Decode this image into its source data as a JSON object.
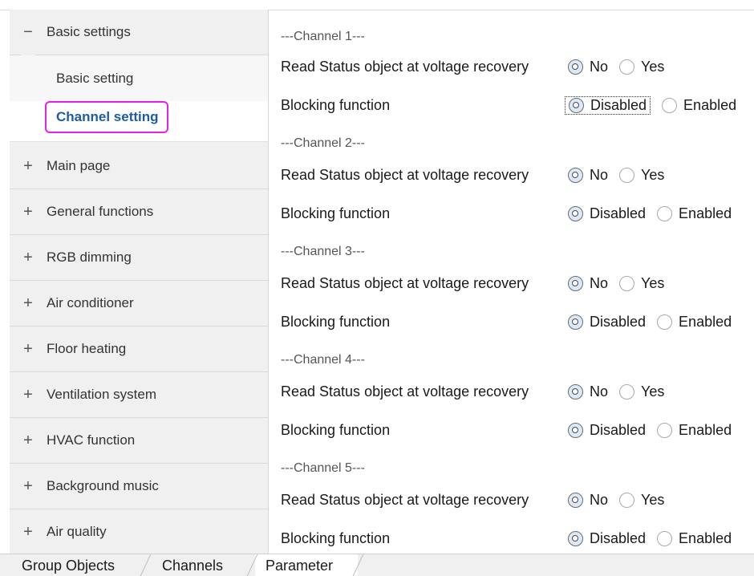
{
  "sidebar": {
    "groups": [
      {
        "sign": "−",
        "label": "Basic settings"
      },
      {
        "sign": "+",
        "label": "Main page"
      },
      {
        "sign": "+",
        "label": "General functions"
      },
      {
        "sign": "+",
        "label": "RGB dimming"
      },
      {
        "sign": "+",
        "label": "Air conditioner"
      },
      {
        "sign": "+",
        "label": "Floor heating"
      },
      {
        "sign": "+",
        "label": "Ventilation system"
      },
      {
        "sign": "+",
        "label": "HVAC function"
      },
      {
        "sign": "+",
        "label": "Background music"
      },
      {
        "sign": "+",
        "label": "Air quality"
      }
    ],
    "subitems": [
      {
        "label": "Basic setting"
      },
      {
        "label": "Channel setting",
        "selected": true
      }
    ],
    "highlight_color": "#e620e6",
    "selected_text_color": "#1e5aa8"
  },
  "parameters": {
    "channels": [
      {
        "header": "---Channel 1---",
        "read_status_label": "Read Status object at voltage recovery",
        "read_status_options": [
          "No",
          "Yes"
        ],
        "read_status_value": "No",
        "blocking_label": "Blocking function",
        "blocking_options": [
          "Disabled",
          "Enabled"
        ],
        "blocking_value": "Disabled"
      },
      {
        "header": "---Channel 2---",
        "read_status_label": "Read Status object at voltage recovery",
        "read_status_options": [
          "No",
          "Yes"
        ],
        "read_status_value": "No",
        "blocking_label": "Blocking function",
        "blocking_options": [
          "Disabled",
          "Enabled"
        ],
        "blocking_value": "Disabled"
      },
      {
        "header": "---Channel 3---",
        "read_status_label": "Read Status object at voltage recovery",
        "read_status_options": [
          "No",
          "Yes"
        ],
        "read_status_value": "No",
        "blocking_label": "Blocking function",
        "blocking_options": [
          "Disabled",
          "Enabled"
        ],
        "blocking_value": "Disabled"
      },
      {
        "header": "---Channel 4---",
        "read_status_label": "Read Status object at voltage recovery",
        "read_status_options": [
          "No",
          "Yes"
        ],
        "read_status_value": "No",
        "blocking_label": "Blocking function",
        "blocking_options": [
          "Disabled",
          "Enabled"
        ],
        "blocking_value": "Disabled"
      },
      {
        "header": "---Channel 5---",
        "read_status_label": "Read Status object at voltage recovery",
        "read_status_options": [
          "No",
          "Yes"
        ],
        "read_status_value": "No",
        "blocking_label": "Blocking function",
        "blocking_options": [
          "Disabled",
          "Enabled"
        ],
        "blocking_value": "Disabled"
      }
    ]
  },
  "tabs": [
    {
      "label": "Group Objects"
    },
    {
      "label": "Channels"
    },
    {
      "label": "Parameter",
      "active": true
    }
  ]
}
